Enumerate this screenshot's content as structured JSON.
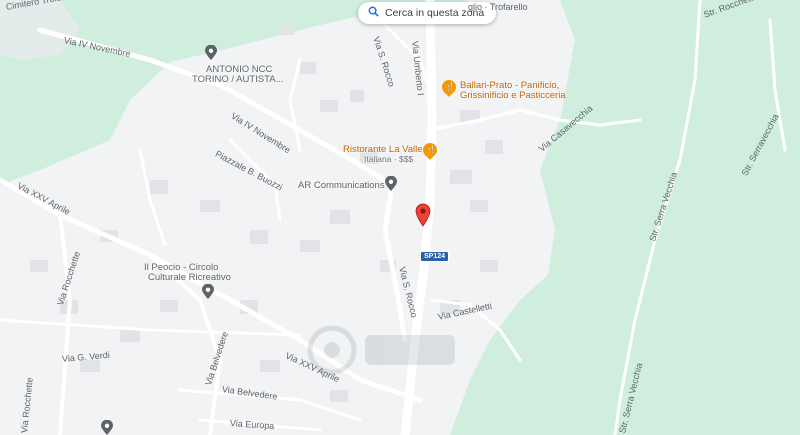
{
  "search": {
    "label": "Cerca in questa zona"
  },
  "labels": {
    "cimitero": "Cimitero Trofarello",
    "via_iv_novembre_top": "Via IV Novembre",
    "via_iv_novembre_mid": "Via IV Novembre",
    "via_s_rocco_top": "Via S. Rocco",
    "via_umberto": "Via Umberto I",
    "trofarello_top": "glio · Trofarello",
    "via_casavecchia": "Via Casavecchia",
    "str_rocchette": "Str. Rocchette",
    "str_serravecchia": "Str. Serravecchia",
    "str_serra_vecchia_mid": "Str. Serra Vecchia",
    "str_serra_vecchia_bot": "Str. Serra Vecchia",
    "piazzale": "Piazzale B. Buozzi",
    "via_xxv_aprile_left": "Via XXV Aprile",
    "via_xxv_aprile_bottom": "Via XXV Aprile",
    "via_rocchette_left": "Via Rocchette",
    "via_rocchette_bottom": "Via Rocchette",
    "via_s_rocco_mid": "Via S. Rocco",
    "via_castelletti": "Via Castelletti",
    "via_g_verdi": "Via G. Verdi",
    "via_belvedere_v": "Via Belvedere",
    "via_belvedere_h": "Via Belvedere",
    "via_europa": "Via Europa"
  },
  "pois": {
    "ncc_line1": "ANTONIO NCC",
    "ncc_line2": "TORINO / AUTISTA...",
    "ballari_line1": "Ballari-Prato - Panificio,",
    "ballari_line2": "Grissinificio e Pasticceria",
    "ristorante": "Ristorante La Valle",
    "ristorante_sub": "Italiana · $$$",
    "ar": "AR Communications",
    "peocio_line1": "Il Peocio - Circolo",
    "peocio_line2": "Culturale Ricreativo"
  },
  "road_shield": "SP124",
  "icons": [
    "search-icon",
    "location-pin-icon",
    "food-icon",
    "place-pin-icon"
  ],
  "colors": {
    "park": "#cfeedd",
    "urban": "#f1f3f4",
    "road": "#ffffff",
    "marker": "#ea4335",
    "food": "#f29900",
    "poi_gray": "#5f6368",
    "shield": "#2962a8"
  }
}
